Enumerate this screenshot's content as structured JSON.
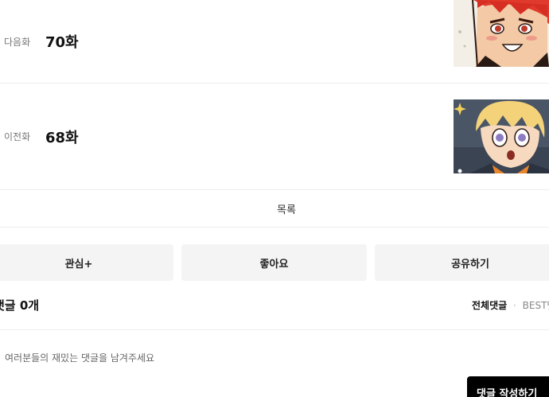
{
  "episodes": {
    "next": {
      "tag": "다음화",
      "title": "70화"
    },
    "prev": {
      "tag": "이전화",
      "title": "68화"
    }
  },
  "list_label": "목록",
  "actions": {
    "interest": "관심+",
    "like": "좋아요",
    "share": "공유하기"
  },
  "comments": {
    "count_label": "댓글 0개",
    "tab_all": "전체댓글",
    "tab_separator": "·",
    "tab_best": "BEST댓글",
    "placeholder": "여러분들의 재밌는 댓글을 남겨주세요",
    "write_button": "댓글 작성하기"
  }
}
